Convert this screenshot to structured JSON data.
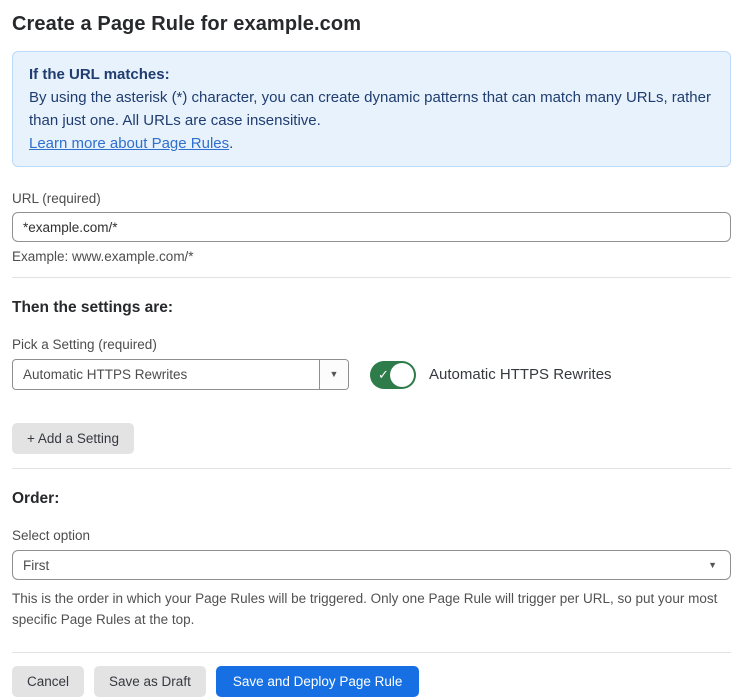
{
  "page": {
    "title": "Create a Page Rule for example.com"
  },
  "info_box": {
    "heading": "If the URL matches:",
    "body": "By using the asterisk (*) character, you can create dynamic patterns that can match many URLs, rather than just one. All URLs are case insensitive.",
    "link_label": "Learn more about Page Rules",
    "link_suffix": "."
  },
  "url_field": {
    "label": "URL (required)",
    "value": "*example.com/*",
    "helper": "Example: www.example.com/*"
  },
  "settings_section": {
    "heading": "Then the settings are:",
    "picker_label": "Pick a Setting (required)",
    "selected_setting": "Automatic HTTPS Rewrites",
    "toggle_state": "on",
    "toggle_label": "Automatic HTTPS Rewrites",
    "add_setting_label": "+ Add a Setting"
  },
  "order_section": {
    "heading": "Order:",
    "select_label": "Select option",
    "selected_option": "First",
    "helper": "This is the order in which your Page Rules will be triggered. Only one Page Rule will trigger per URL, so put your most specific Page Rules at the top."
  },
  "footer": {
    "cancel_label": "Cancel",
    "save_draft_label": "Save as Draft",
    "save_deploy_label": "Save and Deploy Page Rule"
  },
  "icons": {
    "dropdown_arrow": "▼",
    "toggle_check": "✓"
  },
  "colors": {
    "accent_blue": "#1670e3",
    "toggle_green": "#2d7c4a",
    "info_bg": "#e8f2fc",
    "info_border": "#bcd9f7",
    "info_text": "#1f3d70",
    "link_blue": "#2f6fce"
  }
}
